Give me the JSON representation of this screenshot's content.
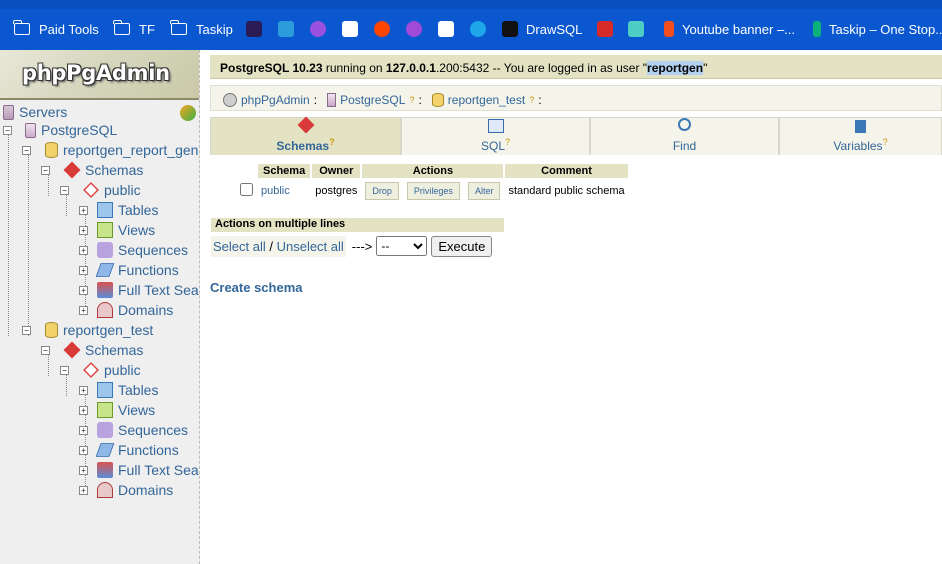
{
  "bookmarks": [
    {
      "label": "Paid Tools",
      "icon": "folder-icon"
    },
    {
      "label": "TF",
      "icon": "folder-icon"
    },
    {
      "label": "Taskip",
      "icon": "folder-icon"
    },
    {
      "label": "",
      "icon": "terminal-icon"
    },
    {
      "label": "",
      "icon": "chat-icon"
    },
    {
      "label": "",
      "icon": "x-icon"
    },
    {
      "label": "",
      "icon": "app-icon"
    },
    {
      "label": "",
      "icon": "reddit-icon"
    },
    {
      "label": "",
      "icon": "messenger-icon"
    },
    {
      "label": "",
      "icon": "app-icon"
    },
    {
      "label": "",
      "icon": "app-icon"
    },
    {
      "label": "DrawSQL",
      "icon": "drawsql-icon"
    },
    {
      "label": "",
      "icon": "app-icon"
    },
    {
      "label": "",
      "icon": "app-icon"
    },
    {
      "label": "Youtube banner –...",
      "icon": "figma-icon"
    },
    {
      "label": "Taskip – One Stop...",
      "icon": "taskip-icon"
    }
  ],
  "logo": "phpPgAdmin",
  "tree": {
    "servers": "Servers",
    "postgresql": "PostgreSQL",
    "db1": "reportgen_report_genix",
    "db1_schemas": "Schemas",
    "db1_public": "public",
    "db1_items": [
      "Tables",
      "Views",
      "Sequences",
      "Functions",
      "Full Text Search",
      "Domains"
    ],
    "db2": "reportgen_test",
    "db2_schemas": "Schemas",
    "db2_public": "public",
    "db2_items": [
      "Tables",
      "Views",
      "Sequences",
      "Functions",
      "Full Text Search",
      "Domains"
    ]
  },
  "topbar": {
    "server": "PostgreSQL 10.23",
    "running_on": " running on ",
    "host": "127.0.0.1",
    "port": "200:5432",
    "logged_in": " -- You are logged in as user \"",
    "user": "reportgen",
    "end": "\""
  },
  "breadcrumb": {
    "app": "phpPgAdmin",
    "server": "PostgreSQL",
    "database": "reportgen_test"
  },
  "tabs": [
    {
      "label": "Schemas",
      "help": "?"
    },
    {
      "label": "SQL",
      "help": "?"
    },
    {
      "label": "Find",
      "help": ""
    },
    {
      "label": "Variables",
      "help": "?"
    }
  ],
  "schemas_table": {
    "headers": [
      "Schema",
      "Owner",
      "Actions",
      "Comment"
    ],
    "rows": [
      {
        "schema": "public",
        "owner": "postgres",
        "actions": [
          "Drop",
          "Privileges",
          "Alter"
        ],
        "comment": "standard public schema"
      }
    ]
  },
  "multi": {
    "header": "Actions on multiple lines",
    "select_all": "Select all",
    "slash": " / ",
    "unselect_all": "Unselect all",
    "arrow": "--->",
    "select_value": "--",
    "execute": "Execute"
  },
  "create_schema": "Create schema"
}
